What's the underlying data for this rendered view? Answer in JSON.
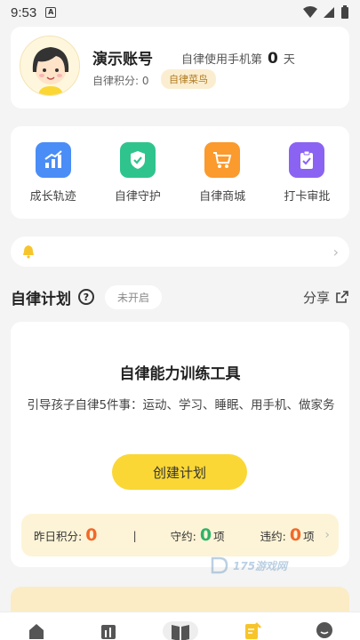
{
  "status_bar": {
    "time": "9:53",
    "notif": "A"
  },
  "profile": {
    "username": "演示账号",
    "selfuse_label": "自律使用手机第",
    "days": "0",
    "days_unit": "天",
    "points": "自律积分: 0",
    "level": "自律菜鸟"
  },
  "features": [
    {
      "label": "成长轨迹",
      "icon": "growth-chart-icon",
      "color": "#4a8df6"
    },
    {
      "label": "自律守护",
      "icon": "shield-check-icon",
      "color": "#2fc48d"
    },
    {
      "label": "自律商城",
      "icon": "cart-icon",
      "color": "#fb9a2d"
    },
    {
      "label": "打卡审批",
      "icon": "clipboard-check-icon",
      "color": "#8b63f2"
    }
  ],
  "plan_section": {
    "title": "自律计划",
    "help": "?",
    "state": "未开启",
    "share": "分享"
  },
  "plan_card": {
    "title": "自律能力训练工具",
    "description": "引导孩子自律5件事：运动、学习、睡眠、用手机、做家务",
    "button": "创建计划",
    "yesterday_label": "昨日积分:",
    "yesterday_value": "0",
    "separator": "|",
    "keep_label": "守约:",
    "keep_value": "0",
    "keep_unit": "项",
    "break_label": "违约:",
    "break_value": "0",
    "break_unit": "项"
  },
  "watermark": {
    "text": "175游戏网"
  },
  "tabbar": [
    "home-icon",
    "stats-icon",
    "book-icon",
    "plan-icon",
    "profile-icon"
  ],
  "colors": {
    "accent": "#fad735",
    "red": "#f06a2a",
    "green": "#2fb36a"
  }
}
